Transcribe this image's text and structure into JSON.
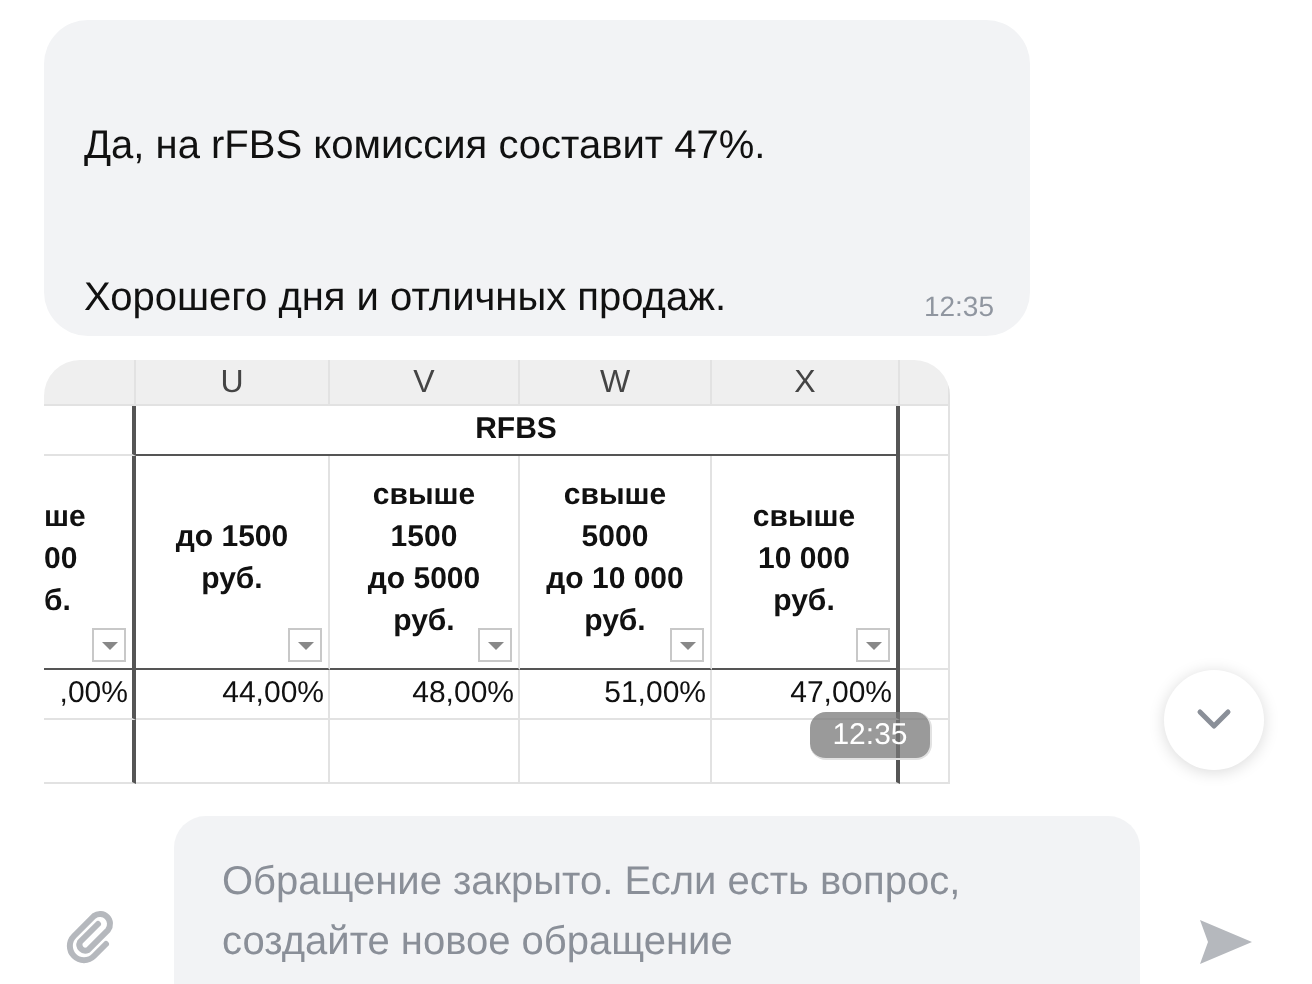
{
  "messages": [
    {
      "kind": "text",
      "paragraphs": [
        "Да, на rFBS комиссия составит 47%.",
        "Хорошего дня и отличных продаж."
      ],
      "time": "12:35"
    },
    {
      "kind": "spreadsheet",
      "column_letters": [
        "U",
        "V",
        "W",
        "X"
      ],
      "group_header": "RFBS",
      "headers": [
        "ше\n00\nб.",
        "до 1500\nруб.",
        "свыше\n1500\nдо 5000\nруб.",
        "свыше\n5000\nдо 10 000\nруб.",
        "свыше\n10 000\nруб."
      ],
      "values": [
        ",00%",
        "44,00%",
        "48,00%",
        "51,00%",
        "47,00%"
      ],
      "time": "12:35"
    }
  ],
  "input": {
    "placeholder": "Обращение закрыто. Если есть вопрос, создайте новое обращение"
  }
}
